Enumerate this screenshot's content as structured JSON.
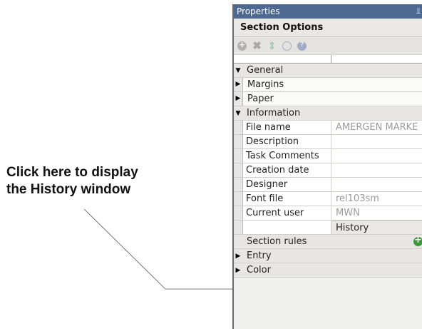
{
  "callout": {
    "line1": "Click here to display",
    "line2": "the History window"
  },
  "panel": {
    "title": "Properties",
    "pin_icon": "pin-icon",
    "section_title": "Section Options",
    "toolbar_icons": [
      "add-icon",
      "delete-icon",
      "move-icon",
      "info-icon",
      "help-icon"
    ]
  },
  "grid": {
    "general": "General",
    "margins": "Margins",
    "paper": "Paper",
    "information": "Information",
    "fields": [
      {
        "name": "File name",
        "value": "AMERGEN MARKE"
      },
      {
        "name": "Description",
        "value": ""
      },
      {
        "name": "Task Comments",
        "value": ""
      },
      {
        "name": "Creation date",
        "value": ""
      },
      {
        "name": "Designer",
        "value": ""
      },
      {
        "name": "Font file",
        "value": "rel103sm"
      },
      {
        "name": "Current user",
        "value": "MWN"
      }
    ],
    "history_button": "History",
    "section_rules": "Section rules",
    "entry": "Entry",
    "color": "Color"
  }
}
